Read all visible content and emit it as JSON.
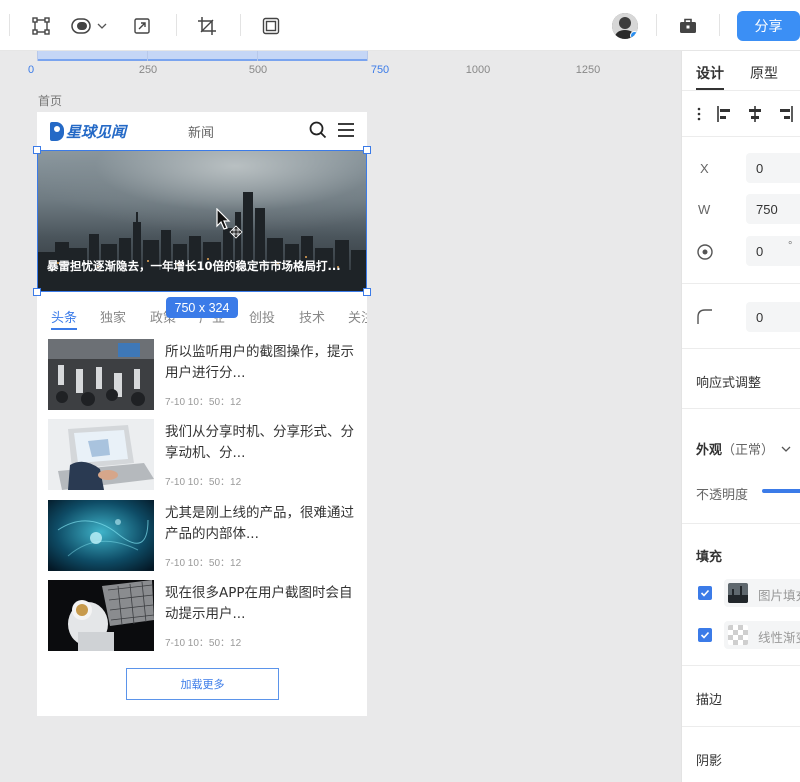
{
  "toolbar": {
    "share_label": "分享",
    "icons": [
      "selection-frame-icon",
      "boolean-shape-icon",
      "export-icon",
      "crop-icon",
      "frame-icon",
      "toolbox-icon"
    ]
  },
  "ruler": {
    "labels": [
      "0",
      "250",
      "500",
      "750",
      "1000",
      "1250"
    ]
  },
  "canvas": {
    "frame_title": "首页",
    "selection_size": "750 x 324"
  },
  "artboard": {
    "header_nav": "新闻",
    "logo_text": "星球见闻",
    "hero_caption": "暴雷担忧逐渐隐去，一年增长10倍的稳定市市场格局打...",
    "tabs": [
      "头条",
      "独家",
      "政策",
      "产业",
      "创投",
      "技术",
      "关注"
    ],
    "news": [
      {
        "title": "所以监听用户的截图操作，提示用户进行分...",
        "time": "7-10 10：50：12"
      },
      {
        "title": "我们从分享时机、分享形式、分享动机、分...",
        "time": "7-10 10：50：12"
      },
      {
        "title": "尤其是刚上线的产品，很难通过产品的内部体...",
        "time": "7-10 10：50：12"
      },
      {
        "title": "现在很多APP在用户截图时会自动提示用户...",
        "time": "7-10 10：50：12"
      }
    ],
    "load_more": "加载更多"
  },
  "panel": {
    "tabs": [
      "设计",
      "原型"
    ],
    "x_label": "X",
    "x_value": "0",
    "w_label": "W",
    "w_value": "750",
    "rotation_value": "0",
    "rotation_unit": "°",
    "radius_value": "0",
    "responsive": "响应式调整",
    "appearance": "外观",
    "appearance_state": "（正常）",
    "opacity_label": "不透明度",
    "fill_heading": "填充",
    "fill_items": [
      "图片填充",
      "线性渐变"
    ],
    "stroke": "描边",
    "shadow": "阴影"
  },
  "colors": {
    "accent": "#3b7be8",
    "share_button": "#3b8ff5"
  }
}
